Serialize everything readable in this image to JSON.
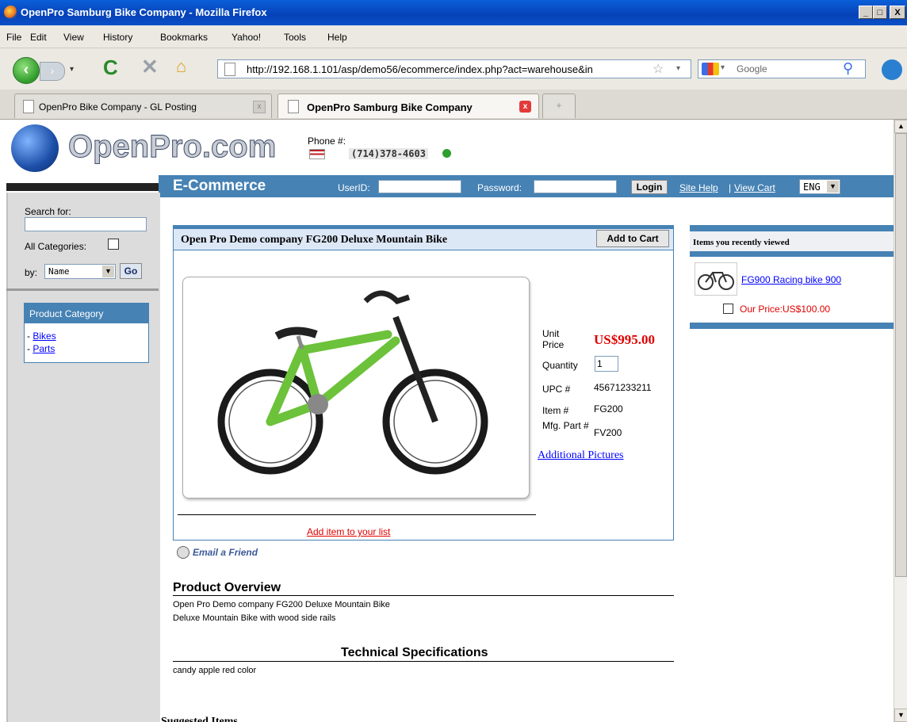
{
  "window": {
    "title": "OpenPro Samburg Bike Company - Mozilla Firefox",
    "min": "_",
    "max": "□",
    "close": "X"
  },
  "menu": [
    "File",
    "Edit",
    "View",
    "History",
    "Bookmarks",
    "Yahoo!",
    "Tools",
    "Help"
  ],
  "nav": {
    "url": "http://192.168.1.101/asp/demo56/ecommerce/index.php?act=warehouse&in",
    "search_placeholder": "Google"
  },
  "tabs": [
    {
      "label": "OpenPro Bike Company - GL Posting",
      "active": false
    },
    {
      "label": "OpenPro Samburg Bike Company",
      "active": true
    }
  ],
  "header": {
    "logo": "OpenPro.com",
    "phone_label": "Phone #:",
    "phone": "(714)378-4603"
  },
  "ecom": {
    "title": "E-Commerce",
    "userid_label": "UserID:",
    "password_label": "Password:",
    "login": "Login",
    "site_help": "Site Help",
    "view_cart": "View Cart",
    "lang": "ENG"
  },
  "sidebar": {
    "search_for": "Search for:",
    "all_categories": "All Categories:",
    "by": "by:",
    "by_value": "Name",
    "go": "Go",
    "category_title": "Product Category",
    "categories": [
      "Bikes",
      "Parts"
    ]
  },
  "product": {
    "title": "Open Pro Demo company FG200 Deluxe Mountain Bike",
    "add_to_cart": "Add to Cart",
    "unit_price_label": "Unit Price",
    "unit_price": "US$995.00",
    "quantity_label": "Quantity",
    "quantity": "1",
    "upc_label": "UPC #",
    "upc": "45671233211",
    "item_label": "Item #",
    "item": "FG200",
    "mfg_label": "Mfg. Part #",
    "mfg": "FV200",
    "additional_pictures": "Additional Pictures",
    "add_to_list": "Add item to your list",
    "email_friend": "Email a Friend"
  },
  "overview": {
    "heading": "Product Overview",
    "line1": "Open Pro Demo company FG200 Deluxe Mountain Bike",
    "line2": "Deluxe Mountain Bike with wood side rails",
    "tech_heading": "Technical Specifications",
    "tech_text": "candy apple red color",
    "suggested": "Suggested Items"
  },
  "recent": {
    "title": "Items you recently viewed",
    "item_link": "FG900 Racing bike 900",
    "price": "Our Price:US$100.00"
  },
  "colors": {
    "bike_green": "#6cc23a",
    "accent_red": "#e00000",
    "bar_blue": "#4682b4"
  }
}
